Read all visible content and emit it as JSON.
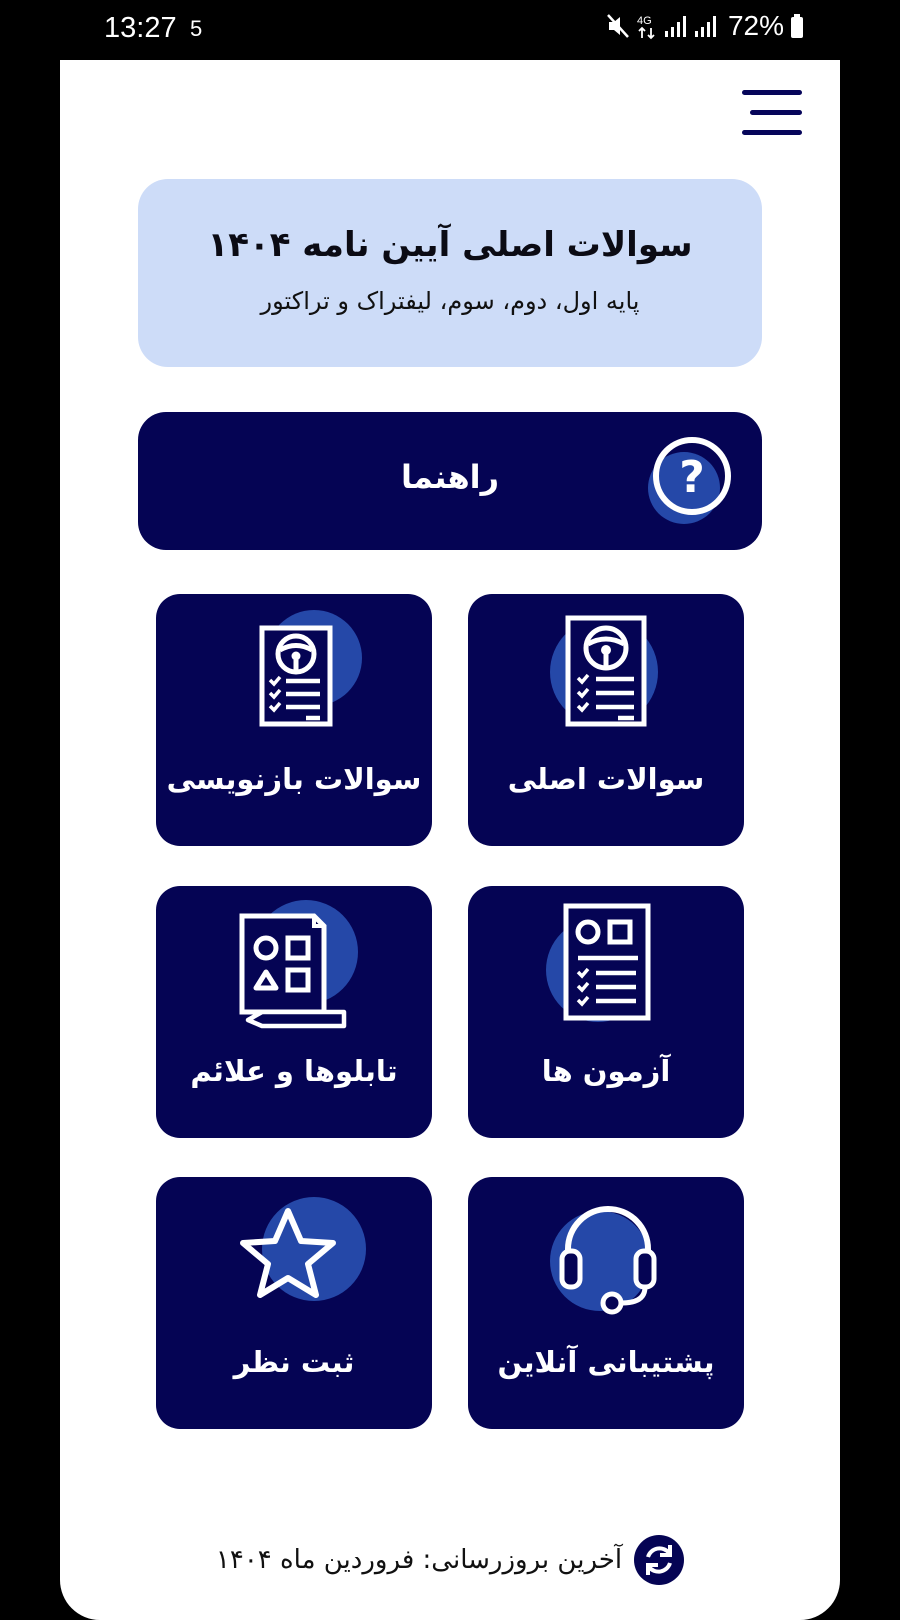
{
  "status_bar": {
    "time": "13:27",
    "notification_count": "5",
    "network": "4G",
    "battery": "72%"
  },
  "header": {
    "title": "سوالات اصلی آیین نامه ۱۴۰۴",
    "subtitle": "پایه اول، دوم، سوم، لیفتراک و تراکتور"
  },
  "guide": {
    "label": "راهنما"
  },
  "tiles": [
    {
      "label": "سوالات اصلی",
      "icon": "exam-sheet-wheel-icon"
    },
    {
      "label": "سوالات بازنویسی",
      "icon": "exam-sheet-wheel-icon"
    },
    {
      "label": "آزمون ها",
      "icon": "test-sheet-icon"
    },
    {
      "label": "تابلوها و علائم",
      "icon": "signs-sheet-icon"
    },
    {
      "label": "پشتیبانی آنلاین",
      "icon": "headset-icon"
    },
    {
      "label": "ثبت نظر",
      "icon": "star-icon"
    }
  ],
  "footer": {
    "text": "آخرین بروزرسانی: فروردین ماه ۱۴۰۴"
  },
  "colors": {
    "primary": "#050454",
    "accent": "#2548a8",
    "header_bg": "#cddcf8",
    "background": "#ffffff"
  }
}
